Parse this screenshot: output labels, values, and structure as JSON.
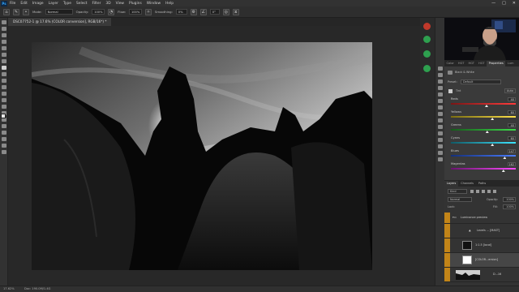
{
  "app": {
    "logo": "Ps"
  },
  "menu": [
    "File",
    "Edit",
    "Image",
    "Layer",
    "Type",
    "Select",
    "Filter",
    "3D",
    "View",
    "Plugins",
    "Window",
    "Help"
  ],
  "window_controls": [
    "—",
    "□",
    "✕"
  ],
  "options": {
    "mode_label": "Mode:",
    "mode_value": "Normal",
    "opacity_label": "Opacity:",
    "opacity_value": "100%",
    "flow_label": "Flow:",
    "flow_value": "100%",
    "smoothing_label": "Smoothing:",
    "smoothing_value": "0%",
    "angle_value": "0°"
  },
  "document_tab": "DSC07752-1 @ 17.6% (COLOR conversion], RGB/16*) *",
  "status": {
    "zoom": "17.62%",
    "doc": "Doc: 190.0M/1.4G"
  },
  "panel_tabs": [
    "Color",
    "HGT",
    "HGT",
    "HGT",
    "Properties",
    "Lum"
  ],
  "properties": {
    "layer_type": "Black & White",
    "preset_label": "Preset:",
    "preset_value": "Default",
    "tint_label": "Tint",
    "auto_label": "Auto",
    "sliders": [
      {
        "label": "Reds",
        "value": "40",
        "pos": 0.55
      },
      {
        "label": "Yellows",
        "value": "60",
        "pos": 0.64
      },
      {
        "label": "Greens",
        "value": "40",
        "pos": 0.56
      },
      {
        "label": "Cyans",
        "value": "60",
        "pos": 0.64
      },
      {
        "label": "Blues",
        "value": "147",
        "pos": 0.83
      },
      {
        "label": "Magentas",
        "value": "162",
        "pos": 0.81
      }
    ]
  },
  "layers": {
    "tabs": [
      "Layers",
      "Channels",
      "Paths"
    ],
    "kind_label": "Kind",
    "blend_label": "Normal",
    "opacity_label": "Opacity:",
    "opacity_value": "100%",
    "lock_label": "Lock:",
    "fill_label": "Fill:",
    "fill_value": "100%",
    "group_name": "Luminance preview",
    "items": [
      {
        "name": "Levels ... [MAST]"
      },
      {
        "name": "1:1.5 [local]"
      },
      {
        "name": "[COLOR...ersion]"
      },
      {
        "name": "D...16"
      }
    ]
  },
  "colors": {
    "accent": "#31a8ff",
    "eye": "#c28418"
  }
}
